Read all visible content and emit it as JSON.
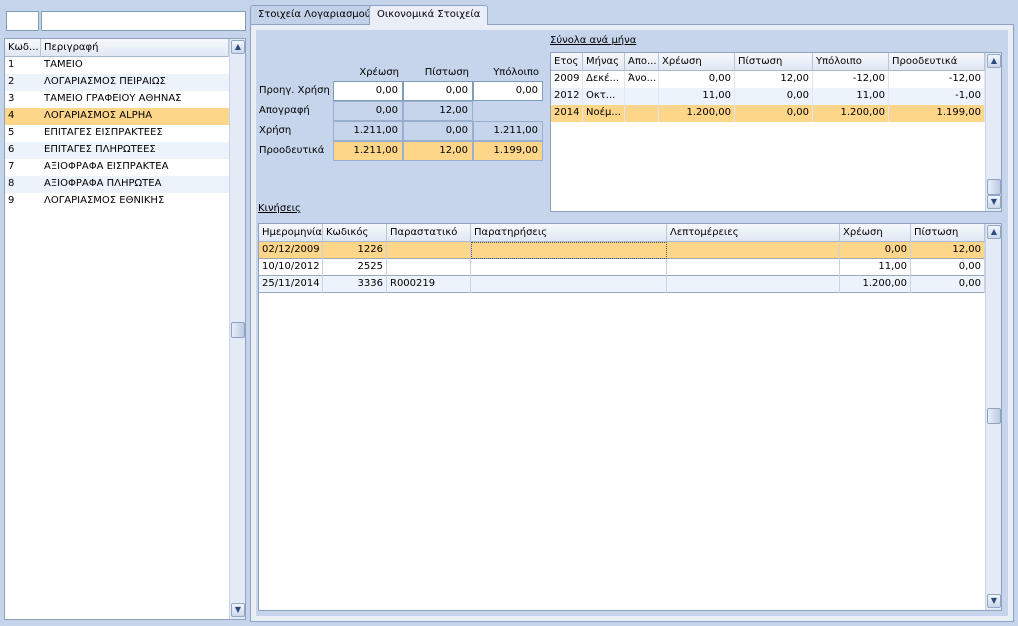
{
  "filter": {
    "code_value": "",
    "desc_value": ""
  },
  "accounts": {
    "headers": {
      "code": "Κωδ...",
      "desc": "Περιγραφή"
    },
    "rows": [
      {
        "code": "1",
        "desc": "ΤΑΜΕΙΟ"
      },
      {
        "code": "2",
        "desc": "ΛΟΓΑΡΙΑΣΜΟΣ ΠΕΙΡΑΙΩΣ"
      },
      {
        "code": "3",
        "desc": "ΤΑΜΕΙΟ ΓΡΑΦΕΙΟΥ ΑΘΗΝΑΣ"
      },
      {
        "code": "4",
        "desc": "ΛΟΓΑΡΙΑΣΜΟΣ ALPHA"
      },
      {
        "code": "5",
        "desc": "ΕΠΙΤΑΓΕΣ ΕΙΣΠΡΑΚΤΕΕΣ"
      },
      {
        "code": "6",
        "desc": "ΕΠΙΤΑΓΕΣ ΠΛΗΡΩΤΕΕΣ"
      },
      {
        "code": "7",
        "desc": "ΑΞΙΟΦΡΑΦΑ ΕΙΣΠΡΑΚΤΕΑ"
      },
      {
        "code": "8",
        "desc": "ΑΞΙΟΦΡΑΦΑ ΠΛΗΡΩΤΕΑ"
      },
      {
        "code": "9",
        "desc": "ΛΟΓΑΡΙΑΣΜΟΣ ΕΘΝΙΚΗΣ"
      }
    ]
  },
  "tabs": {
    "account": "Στοιχεία Λογαριασμού",
    "financial": "Οικονομικά Στοιχεία"
  },
  "summary": {
    "col_debit": "Χρέωση",
    "col_credit": "Πίστωση",
    "col_balance": "Υπόλοιπο",
    "rows": [
      {
        "label": "Προηγ. Χρήση",
        "debit": "0,00",
        "credit": "0,00",
        "balance": "0,00"
      },
      {
        "label": "Απογραφή",
        "debit": "0,00",
        "credit": "12,00",
        "balance": ""
      },
      {
        "label": "Χρήση",
        "debit": "1.211,00",
        "credit": "0,00",
        "balance": "1.211,00"
      },
      {
        "label": "Προοδευτικά",
        "debit": "1.211,00",
        "credit": "12,00",
        "balance": "1.199,00"
      }
    ]
  },
  "monthly": {
    "title": "Σύνολα ανά μήνα",
    "headers": {
      "year": "Ετος",
      "month": "Μήνας",
      "apo": "Απο...",
      "debit": "Χρέωση",
      "credit": "Πίστωση",
      "balance": "Υπόλοιπο",
      "progressive": "Προοδευτικά"
    },
    "rows": [
      {
        "year": "2009",
        "month": "Δεκέ...",
        "apo": "Άνο...",
        "debit": "0,00",
        "credit": "12,00",
        "balance": "-12,00",
        "progressive": "-12,00"
      },
      {
        "year": "2012",
        "month": "Οκτ...",
        "apo": "",
        "debit": "11,00",
        "credit": "0,00",
        "balance": "11,00",
        "progressive": "-1,00"
      },
      {
        "year": "2014",
        "month": "Νοέμ...",
        "apo": "",
        "debit": "1.200,00",
        "credit": "0,00",
        "balance": "1.200,00",
        "progressive": "1.199,00"
      }
    ]
  },
  "movements": {
    "title": "Κινήσεις",
    "headers": {
      "date": "Ημερομηνία",
      "code": "Κωδικός",
      "doc": "Παραστατικό",
      "notes": "Παρατηρήσεις",
      "details": "Λεπτομέρειες",
      "debit": "Χρέωση",
      "credit": "Πίστωση"
    },
    "rows": [
      {
        "date": "02/12/2009",
        "code": "1226",
        "doc": "",
        "notes": "",
        "details": "",
        "debit": "0,00",
        "credit": "12,00"
      },
      {
        "date": "10/10/2012",
        "code": "2525",
        "doc": "",
        "notes": "",
        "details": "",
        "debit": "11,00",
        "credit": "0,00"
      },
      {
        "date": "25/11/2014",
        "code": "3336",
        "doc": "R000219",
        "notes": "",
        "details": "",
        "debit": "1.200,00",
        "credit": "0,00"
      }
    ]
  },
  "icons": {
    "scroll_up": "chevron-up-icon",
    "scroll_down": "chevron-down-icon"
  },
  "colors": {
    "selected_row": "#fdd68a",
    "alt_row": "#edf3fb",
    "background": "#c5d4ea"
  }
}
